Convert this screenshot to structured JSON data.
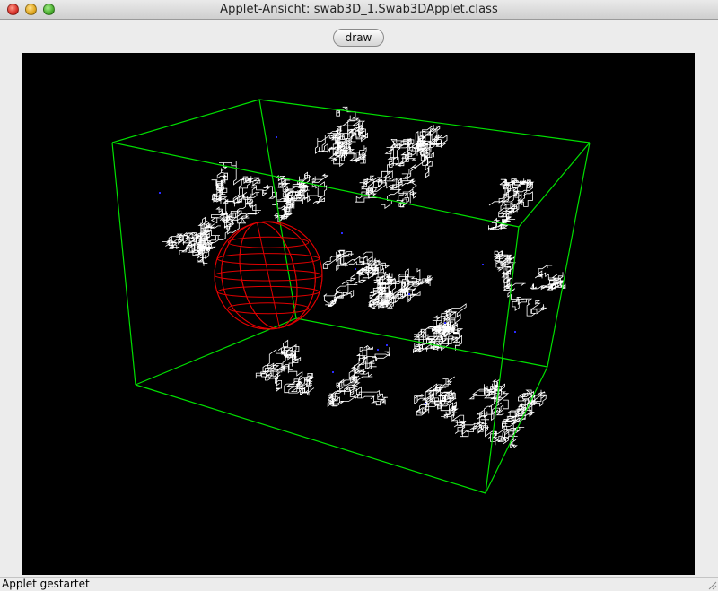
{
  "window": {
    "title": "Applet-Ansicht: swab3D_1.Swab3DApplet.class"
  },
  "toolbar": {
    "draw_label": "draw"
  },
  "status": {
    "text": "Applet gestartet"
  },
  "scene": {
    "background": "#000000",
    "box_color": "#00e000",
    "walk_color": "#ffffff",
    "sphere_color": "#e00000",
    "marker_color": "#2a2aff"
  },
  "icons": {
    "close": "close-icon",
    "minimize": "minimize-icon",
    "zoom": "zoom-icon",
    "resize": "resize-grip-icon"
  }
}
